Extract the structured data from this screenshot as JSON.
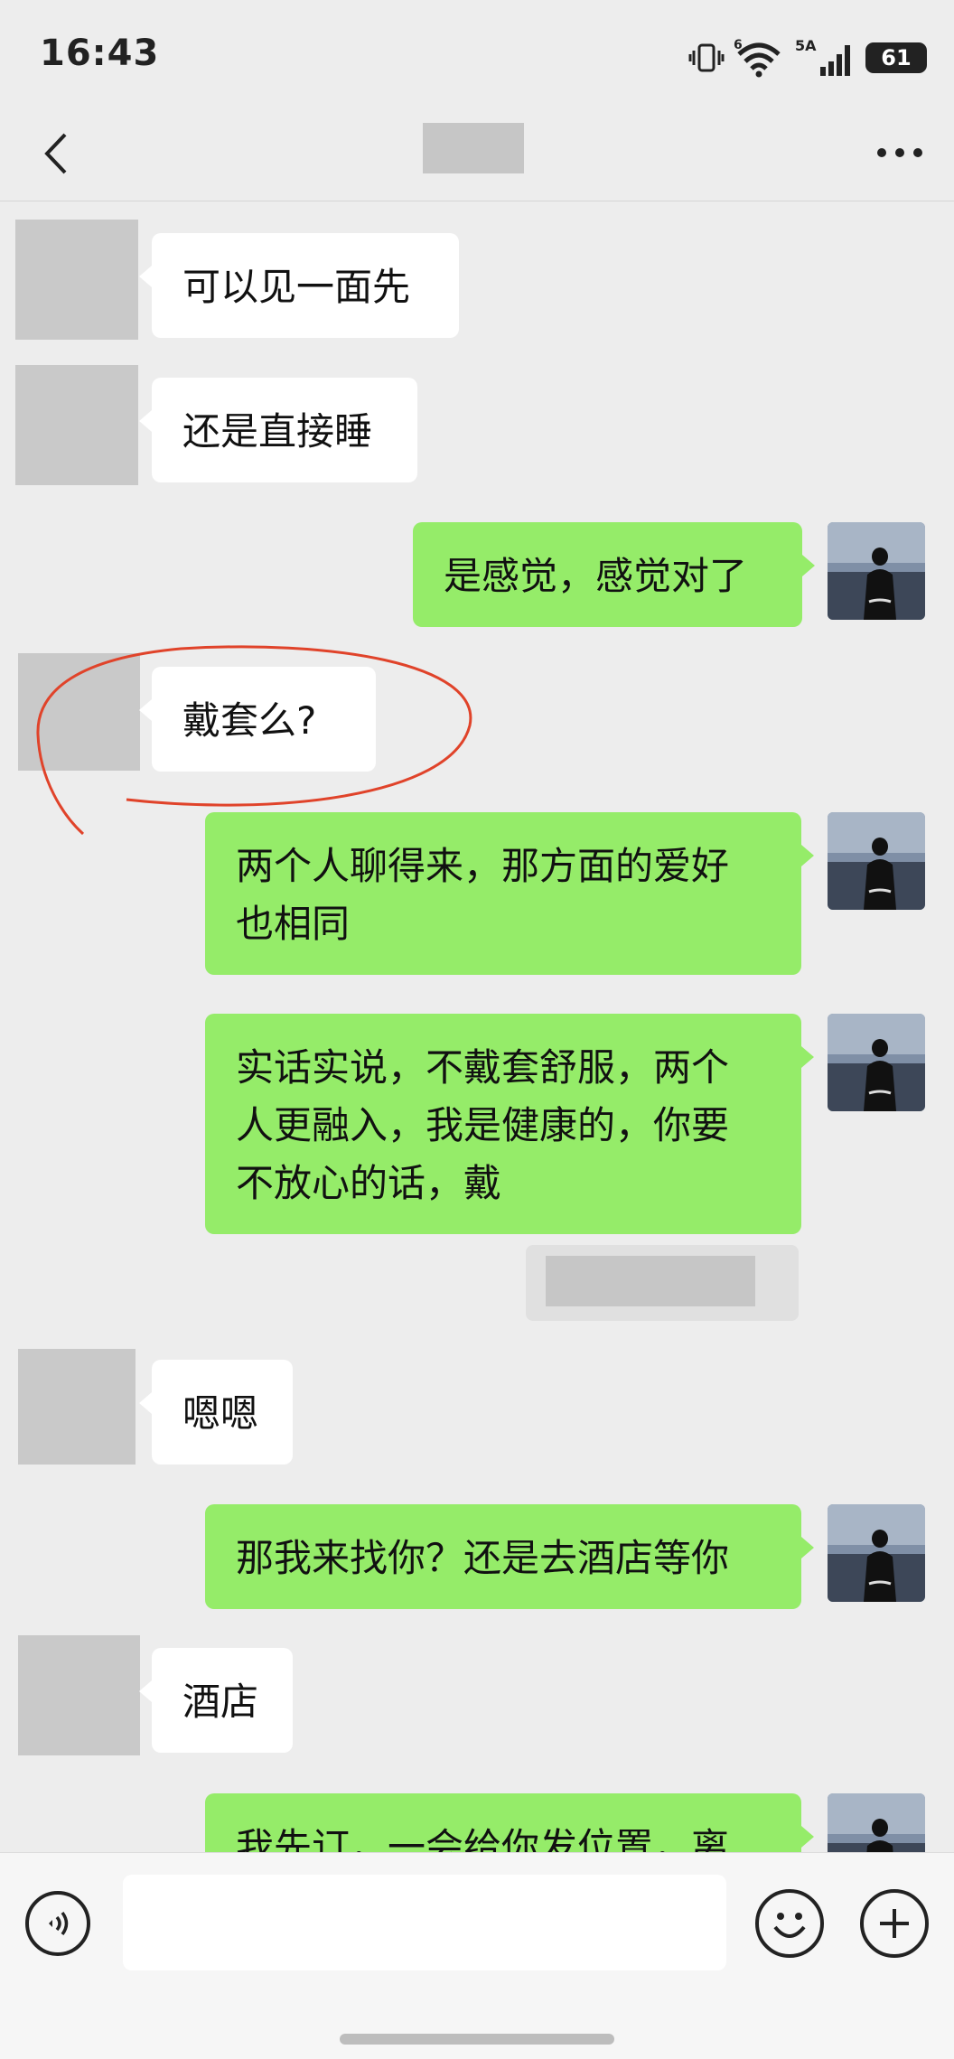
{
  "status_bar": {
    "time": "16:43",
    "wifi_badge": "6",
    "signal_badge": "5A",
    "battery": "61",
    "icons": [
      "vibrate-icon",
      "wifi-icon",
      "signal-icon",
      "battery-icon"
    ]
  },
  "nav": {
    "back_icon": "chevron-left-icon",
    "title_redacted": true,
    "more_icon": "ellipsis-icon"
  },
  "messages": [
    {
      "side": "in",
      "text": "可以见一面先"
    },
    {
      "side": "in",
      "text": "还是直接睡"
    },
    {
      "side": "out",
      "text": "是感觉，感觉对了"
    },
    {
      "side": "in",
      "text": "戴套么?"
    },
    {
      "side": "out",
      "text": "两个人聊得来，那方面的爱好\n也相同"
    },
    {
      "side": "out",
      "text": "实话实说，不戴套舒服，两个\n人更融入，我是健康的，你要\n不放心的话，戴"
    },
    {
      "side": "in",
      "text": "嗯嗯"
    },
    {
      "side": "out",
      "text": "那我来找你？还是去酒店等你"
    },
    {
      "side": "in",
      "text": "酒店"
    },
    {
      "side": "out",
      "text": "我先订，一会给你发位置，离"
    }
  ],
  "input_bar": {
    "placeholder": "",
    "voice_icon": "voice-icon",
    "emoji_icon": "emoji-icon",
    "plus_icon": "plus-icon"
  },
  "colors": {
    "background": "#ededed",
    "outgoing_bubble": "#95ec69",
    "incoming_bubble": "#ffffff",
    "annotation": "#e0432a"
  }
}
